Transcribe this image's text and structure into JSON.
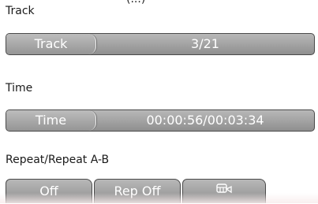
{
  "top_clip": "(...)",
  "track": {
    "section_label": "Track",
    "bar_label": "Track",
    "value": "3/21"
  },
  "time": {
    "section_label": "Time",
    "bar_label": "Time",
    "value": "00:00:56/00:03:34"
  },
  "repeat": {
    "section_label": "Repeat/Repeat A-B",
    "buttons": [
      {
        "label": "Off"
      },
      {
        "label": "Rep Off"
      },
      {
        "label": "",
        "icon": "repeat-ab-icon"
      }
    ]
  },
  "colors": {
    "bar_top": "#b8b8b8",
    "bar_bottom": "#8f8f8f",
    "bar_border": "#4a4a4a",
    "bar_text": "#ffffff"
  }
}
